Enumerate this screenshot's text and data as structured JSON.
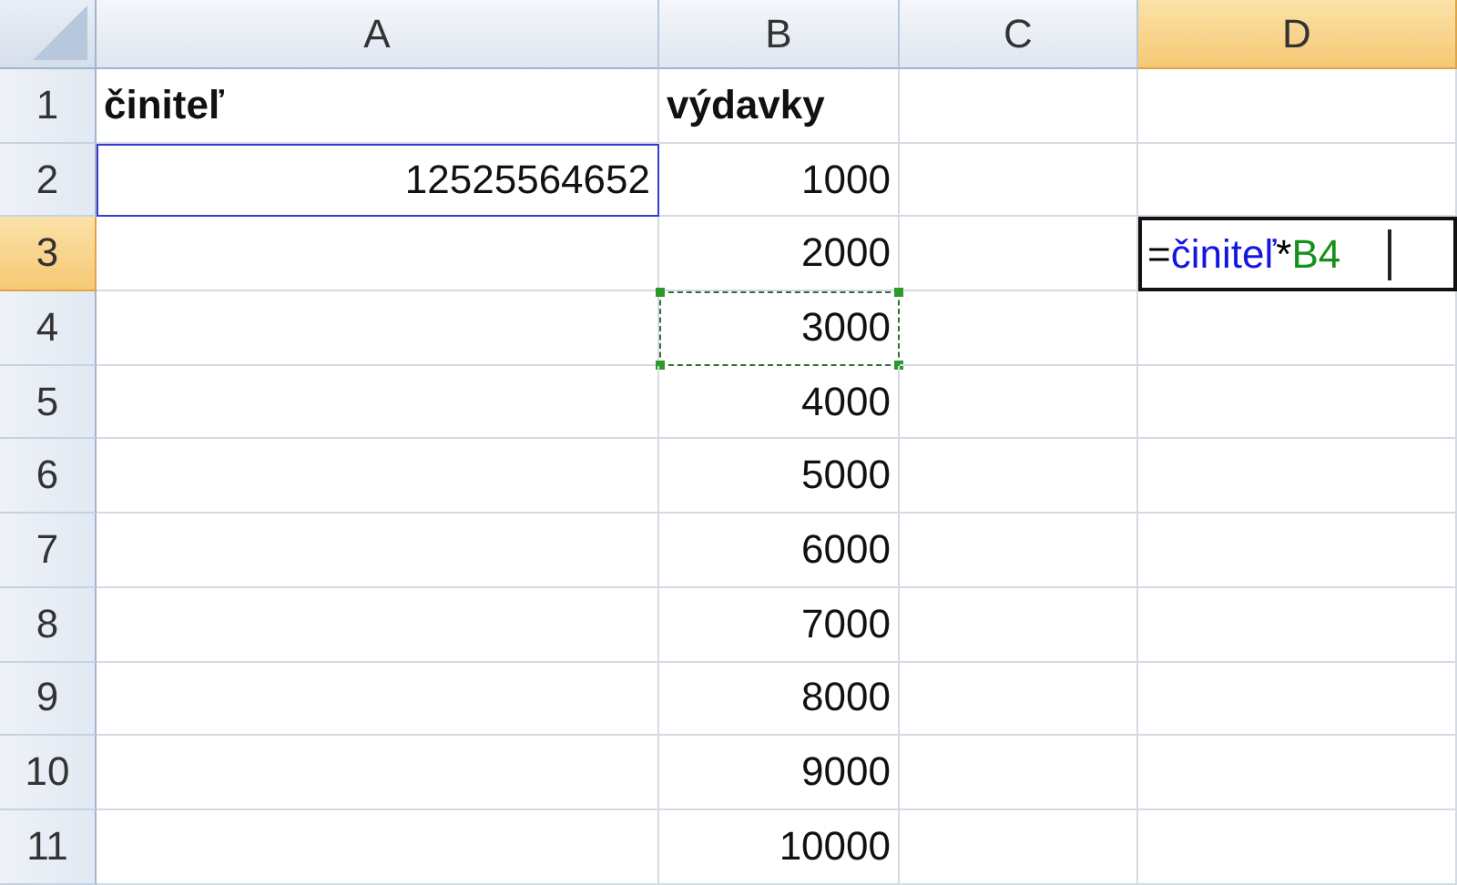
{
  "columns": [
    {
      "label": "A",
      "selected": false
    },
    {
      "label": "B",
      "selected": false
    },
    {
      "label": "C",
      "selected": false
    },
    {
      "label": "D",
      "selected": true
    }
  ],
  "rows": [
    {
      "number": "1",
      "selected": false,
      "cells": [
        {
          "value": "činiteľ",
          "bold": true
        },
        {
          "value": "výdavky",
          "bold": true
        },
        {},
        {}
      ]
    },
    {
      "number": "2",
      "selected": false,
      "cells": [
        {
          "value": "12525564652",
          "name_outline": true
        },
        {
          "value": "1000"
        },
        {},
        {}
      ]
    },
    {
      "number": "3",
      "selected": true,
      "cells": [
        {},
        {
          "value": "2000"
        },
        {},
        {
          "editing": true,
          "formula": [
            {
              "kind": "operator",
              "text": "="
            },
            {
              "kind": "name",
              "text": "činiteľ"
            },
            {
              "kind": "operator",
              "text": "*"
            },
            {
              "kind": "reference",
              "text": "B4"
            }
          ]
        }
      ]
    },
    {
      "number": "4",
      "selected": false,
      "cells": [
        {},
        {
          "value": "3000",
          "reference_outline": true
        },
        {},
        {}
      ]
    },
    {
      "number": "5",
      "selected": false,
      "cells": [
        {},
        {
          "value": "4000"
        },
        {},
        {}
      ]
    },
    {
      "number": "6",
      "selected": false,
      "cells": [
        {},
        {
          "value": "5000"
        },
        {},
        {}
      ]
    },
    {
      "number": "7",
      "selected": false,
      "cells": [
        {},
        {
          "value": "6000"
        },
        {},
        {}
      ]
    },
    {
      "number": "8",
      "selected": false,
      "cells": [
        {},
        {
          "value": "7000"
        },
        {},
        {}
      ]
    },
    {
      "number": "9",
      "selected": false,
      "cells": [
        {},
        {
          "value": "8000"
        },
        {},
        {}
      ]
    },
    {
      "number": "10",
      "selected": false,
      "cells": [
        {},
        {
          "value": "9000"
        },
        {},
        {}
      ]
    },
    {
      "number": "11",
      "selected": false,
      "cells": [
        {},
        {
          "value": "10000"
        },
        {},
        {}
      ]
    }
  ]
}
